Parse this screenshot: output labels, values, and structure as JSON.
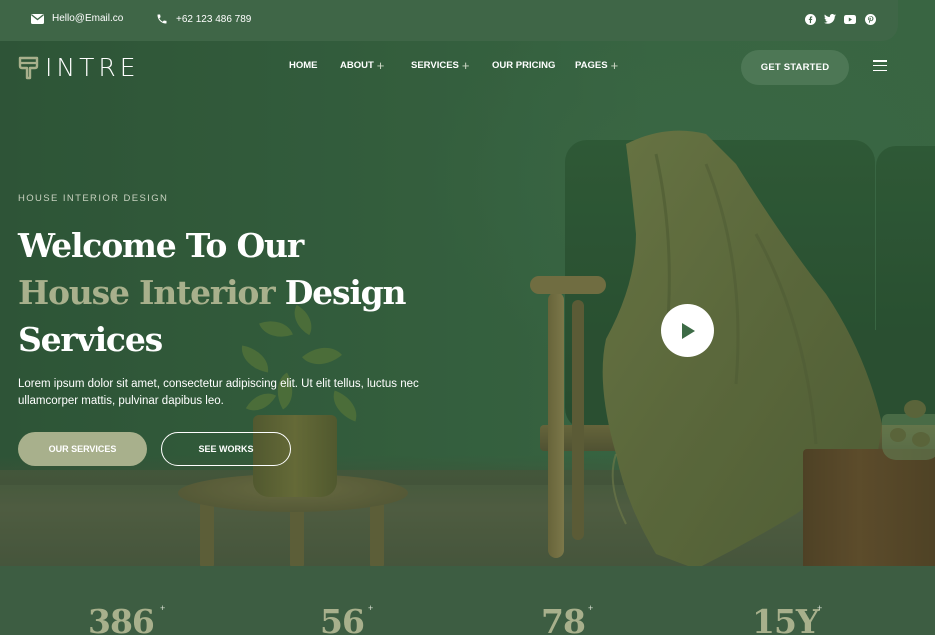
{
  "topbar": {
    "email": "Hello@Email.co",
    "phone": "+62 123 486 789",
    "social": [
      "facebook-icon",
      "twitter-icon",
      "youtube-icon",
      "pinterest-icon"
    ]
  },
  "brand": {
    "logo_text": "INTRE"
  },
  "nav": {
    "items": [
      {
        "label": "HOME",
        "has_plus": false
      },
      {
        "label": "ABOUT",
        "has_plus": true
      },
      {
        "label": "SERVICES",
        "has_plus": true
      },
      {
        "label": "OUR PRICING",
        "has_plus": false
      },
      {
        "label": "PAGES",
        "has_plus": true
      }
    ],
    "plus_symbol": "+",
    "cta_label": "GET STARTED"
  },
  "hero": {
    "eyebrow": "HOUSE INTERIOR DESIGN",
    "title_line1": "Welcome To Our",
    "title_accent": "House Interior",
    "title_line2_rest": " Design",
    "title_line3": "Services",
    "description": "Lorem ipsum dolor sit amet, consectetur adipiscing elit. Ut elit tellus, luctus nec ullamcorper mattis, pulvinar dapibus leo.",
    "primary_button": "OUR SERVICES",
    "secondary_button": "SEE WORKS"
  },
  "stats": [
    {
      "value": "386",
      "suffix": "+"
    },
    {
      "value": "56",
      "suffix": "+"
    },
    {
      "value": "78",
      "suffix": "+"
    },
    {
      "value": "15Y",
      "suffix": "+"
    }
  ],
  "colors": {
    "accent": "#a8b08c",
    "dark_green": "#3c5a40",
    "button_green": "#4d7755"
  }
}
